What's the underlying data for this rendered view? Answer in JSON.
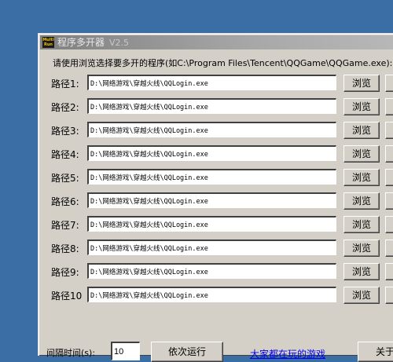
{
  "window": {
    "icon_text": "Multi Run",
    "title": "程序多开器",
    "version": "V2.5"
  },
  "hint": "请使用浏览选择要多开的程序(如C:\\Program Files\\Tencent\\QQGame\\QQGame.exe):",
  "rows": [
    {
      "label": "路径1:",
      "path": "D:\\网络游戏\\穿越火线\\QQLogin.exe",
      "browse": "浏览"
    },
    {
      "label": "路径2:",
      "path": "D:\\网络游戏\\穿越火线\\QQLogin.exe",
      "browse": "浏览"
    },
    {
      "label": "路径3:",
      "path": "D:\\网络游戏\\穿越火线\\QQLogin.exe",
      "browse": "浏览"
    },
    {
      "label": "路径4:",
      "path": "D:\\网络游戏\\穿越火线\\QQLogin.exe",
      "browse": "浏览"
    },
    {
      "label": "路径5:",
      "path": "D:\\网络游戏\\穿越火线\\QQLogin.exe",
      "browse": "浏览"
    },
    {
      "label": "路径6:",
      "path": "D:\\网络游戏\\穿越火线\\QQLogin.exe",
      "browse": "浏览"
    },
    {
      "label": "路径7:",
      "path": "D:\\网络游戏\\穿越火线\\QQLogin.exe",
      "browse": "浏览"
    },
    {
      "label": "路径8:",
      "path": "D:\\网络游戏\\穿越火线\\QQLogin.exe",
      "browse": "浏览"
    },
    {
      "label": "路径9:",
      "path": "D:\\网络游戏\\穿越火线\\QQLogin.exe",
      "browse": "浏览"
    },
    {
      "label": "路径10",
      "path": "D:\\网络游戏\\穿越火线\\QQLogin.exe",
      "browse": "浏览"
    }
  ],
  "footer": {
    "interval_label": "间隔时间(s):",
    "interval_value": "10",
    "run_label": "依次运行",
    "games_link": "大家都在玩的游戏",
    "about_label": "关于"
  }
}
